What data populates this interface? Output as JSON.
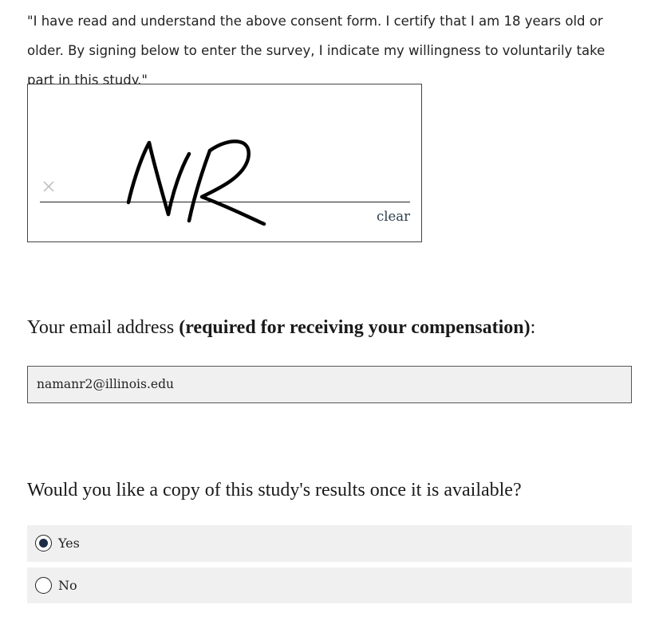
{
  "consent": {
    "text": "\"I have read and understand the above consent form. I certify that I am 18 years old or older. By signing below to enter the survey, I indicate my willingness to voluntarily take part in this study.\""
  },
  "signature": {
    "handwritten": "NR",
    "clear_label": "clear",
    "x_mark": "×"
  },
  "email": {
    "question_prefix": "Your email address ",
    "question_bold": "(required for receiving your compensation)",
    "question_suffix": ":",
    "value": "namanr2@illinois.edu"
  },
  "results": {
    "question": "Would you like a copy of this study's results once it is available?",
    "options": [
      {
        "label": "Yes",
        "selected": true
      },
      {
        "label": "No",
        "selected": false
      }
    ]
  },
  "colors": {
    "accent": "#1d2b44",
    "field_background": "#f0f0f0"
  }
}
